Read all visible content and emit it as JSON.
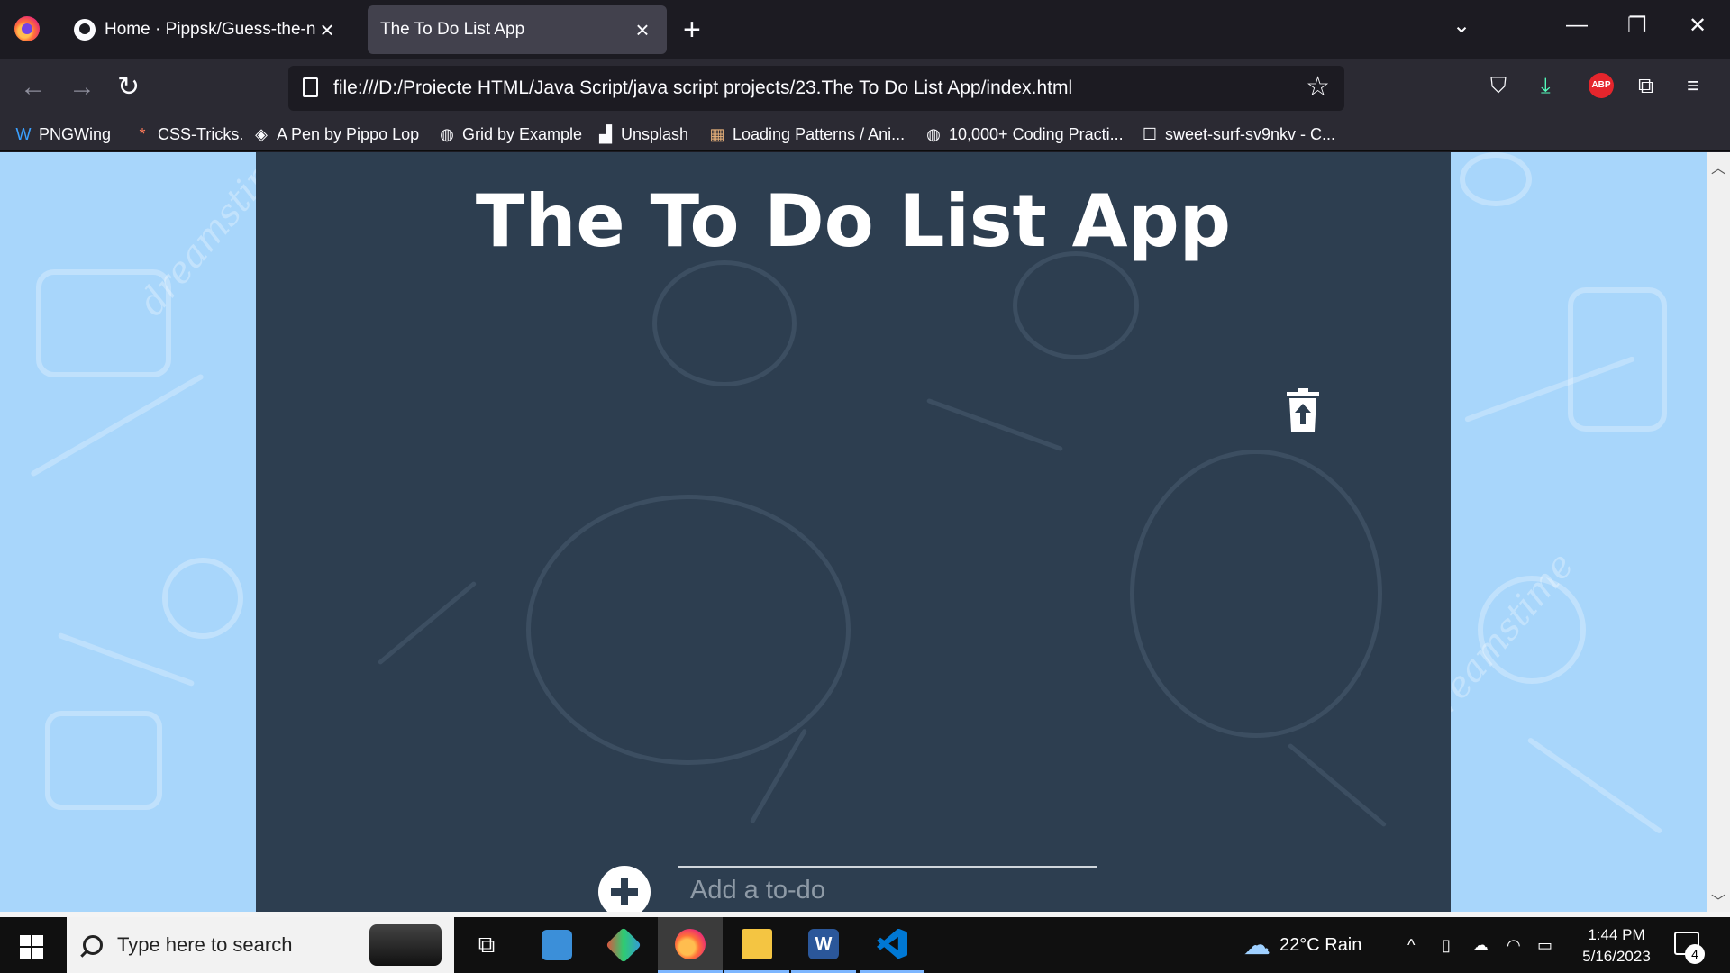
{
  "browser": {
    "tabs": [
      {
        "label": "Home · Pippsk/Guess-the-numb",
        "active": false
      },
      {
        "label": "The To Do List App",
        "active": true
      }
    ],
    "url": "file:///D:/Proiecte HTML/Java Script/java script projects/23.The To Do List App/index.html",
    "bookmarks": [
      {
        "label": "PNGWing",
        "icon": "pngwing-icon"
      },
      {
        "label": "CSS-Tricks.",
        "icon": "css-tricks-icon"
      },
      {
        "label": "A Pen by Pippo Lop",
        "icon": "codepen-icon"
      },
      {
        "label": "Grid by Example",
        "icon": "globe-icon"
      },
      {
        "label": "Unsplash",
        "icon": "unsplash-icon"
      },
      {
        "label": "Loading Patterns / Ani...",
        "icon": "loading-patterns-icon"
      },
      {
        "label": "10,000+ Coding Practi...",
        "icon": "globe-icon"
      },
      {
        "label": "sweet-surf-sv9nkv - C...",
        "icon": "page-icon"
      }
    ]
  },
  "app": {
    "title": "The To Do List App",
    "input_placeholder": "Add a to-do",
    "input_value": "",
    "background_watermark": "dreamstime",
    "colors": {
      "panel": "#2d3e50",
      "page_bg": "#a8d6fb"
    }
  },
  "taskbar": {
    "search_placeholder": "Type here to search",
    "weather": "22°C  Rain",
    "time": "1:44 PM",
    "date": "5/16/2023",
    "notification_count": "4"
  }
}
